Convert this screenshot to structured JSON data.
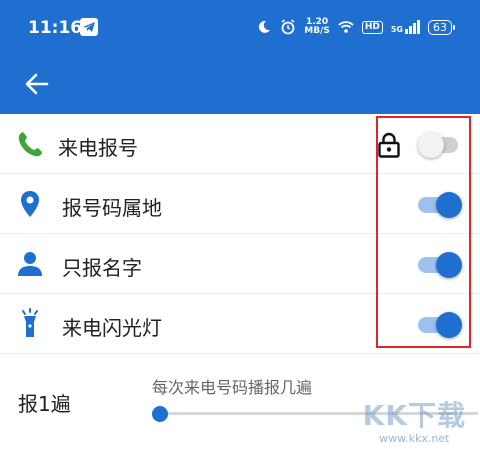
{
  "status_bar": {
    "time": "11:16",
    "speed_top": "1.20",
    "speed_bottom": "MB/S",
    "hd": "HD",
    "signal": "5G",
    "battery": "63"
  },
  "items": [
    {
      "label": "来电报号",
      "icon": "phone-icon",
      "enabled": false,
      "locked": true
    },
    {
      "label": "报号码属地",
      "icon": "location-pin-icon",
      "enabled": true,
      "locked": false
    },
    {
      "label": "只报名字",
      "icon": "person-icon",
      "enabled": true,
      "locked": false
    },
    {
      "label": "来电闪光灯",
      "icon": "flashlight-icon",
      "enabled": true,
      "locked": false
    }
  ],
  "repeat": {
    "label": "报1遍",
    "description": "每次来电号码播报几遍",
    "slider_value": 0
  },
  "watermark": {
    "logo": "KK下载",
    "url": "www.kkx.net"
  },
  "colors": {
    "primary": "#1f6fd1",
    "phone_icon": "#3ea53a",
    "highlight": "#e32424"
  }
}
